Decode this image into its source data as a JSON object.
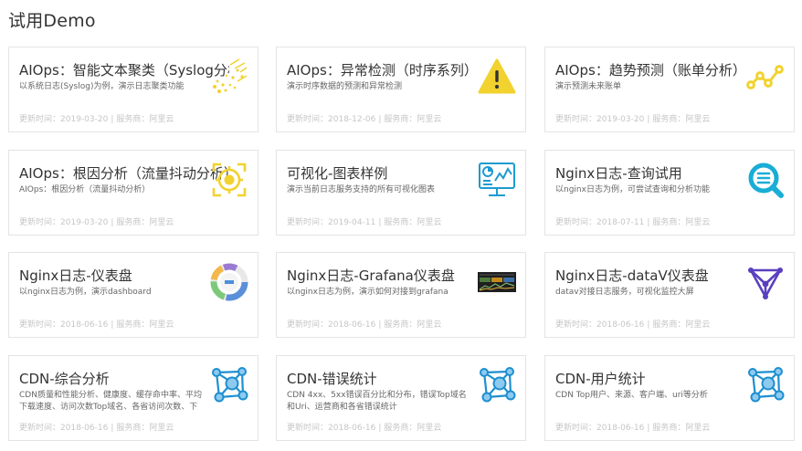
{
  "page": {
    "title": "试用Demo"
  },
  "labels": {
    "updated_prefix": "更新时间：",
    "provider_prefix": "服务商：",
    "separator": "|"
  },
  "cards": [
    {
      "title": "AIOps：智能文本聚类（Syslog分析）",
      "desc": "以系统日志(Syslog)为例，演示日志聚类功能",
      "updated": "2019-03-20",
      "provider": "阿里云",
      "icon": "sparkle-cluster-icon"
    },
    {
      "title": "AIOps：异常检测（时序系列）",
      "desc": "演示时序数据的预测和异常检测",
      "updated": "2018-12-06",
      "provider": "阿里云",
      "icon": "warning-icon"
    },
    {
      "title": "AIOps：趋势预测（账单分析）",
      "desc": "演示预测未来账单",
      "updated": "2019-03-20",
      "provider": "阿里云",
      "icon": "trend-line-icon"
    },
    {
      "title": "AIOps：根因分析（流量抖动分析）",
      "desc": "AIOps：根因分析（流量抖动分析）",
      "updated": "2019-03-20",
      "provider": "阿里云",
      "icon": "target-icon"
    },
    {
      "title": "可视化-图表样例",
      "desc": "演示当前日志服务支持的所有可视化图表",
      "updated": "2019-04-11",
      "provider": "阿里云",
      "icon": "monitor-chart-icon"
    },
    {
      "title": "Nginx日志-查询试用",
      "desc": "以nginx日志为例，可尝试查询和分析功能",
      "updated": "2018-07-11",
      "provider": "阿里云",
      "icon": "search-list-icon"
    },
    {
      "title": "Nginx日志-仪表盘",
      "desc": "以nginx日志为例，演示dashboard",
      "updated": "2018-06-16",
      "provider": "阿里云",
      "icon": "donut-chart-icon"
    },
    {
      "title": "Nginx日志-Grafana仪表盘",
      "desc": "以nginx日志为例，演示如何对接到grafana",
      "updated": "2018-06-16",
      "provider": "阿里云",
      "icon": "grafana-dashboard-icon"
    },
    {
      "title": "Nginx日志-dataV仪表盘",
      "desc": "datav对接日志服务，可视化监控大屏",
      "updated": "2018-06-16",
      "provider": "阿里云",
      "icon": "datav-triangle-icon"
    },
    {
      "title": "CDN-综合分析",
      "desc": "CDN质量和性能分析、健康度、缓存命中率、平均下载速度、访问次数Top域名、各省访问次数、下",
      "updated": "2018-06-16",
      "provider": "阿里云",
      "icon": "network-nodes-icon"
    },
    {
      "title": "CDN-错误统计",
      "desc": "CDN 4xx、5xx错误百分比和分布，错误Top域名和Uri、运营商和各省错误统计",
      "updated": "2018-06-16",
      "provider": "阿里云",
      "icon": "network-nodes-icon"
    },
    {
      "title": "CDN-用户统计",
      "desc": "CDN Top用户、来源、客户端、uri等分析",
      "updated": "2018-06-16",
      "provider": "阿里云",
      "icon": "network-nodes-icon"
    }
  ]
}
